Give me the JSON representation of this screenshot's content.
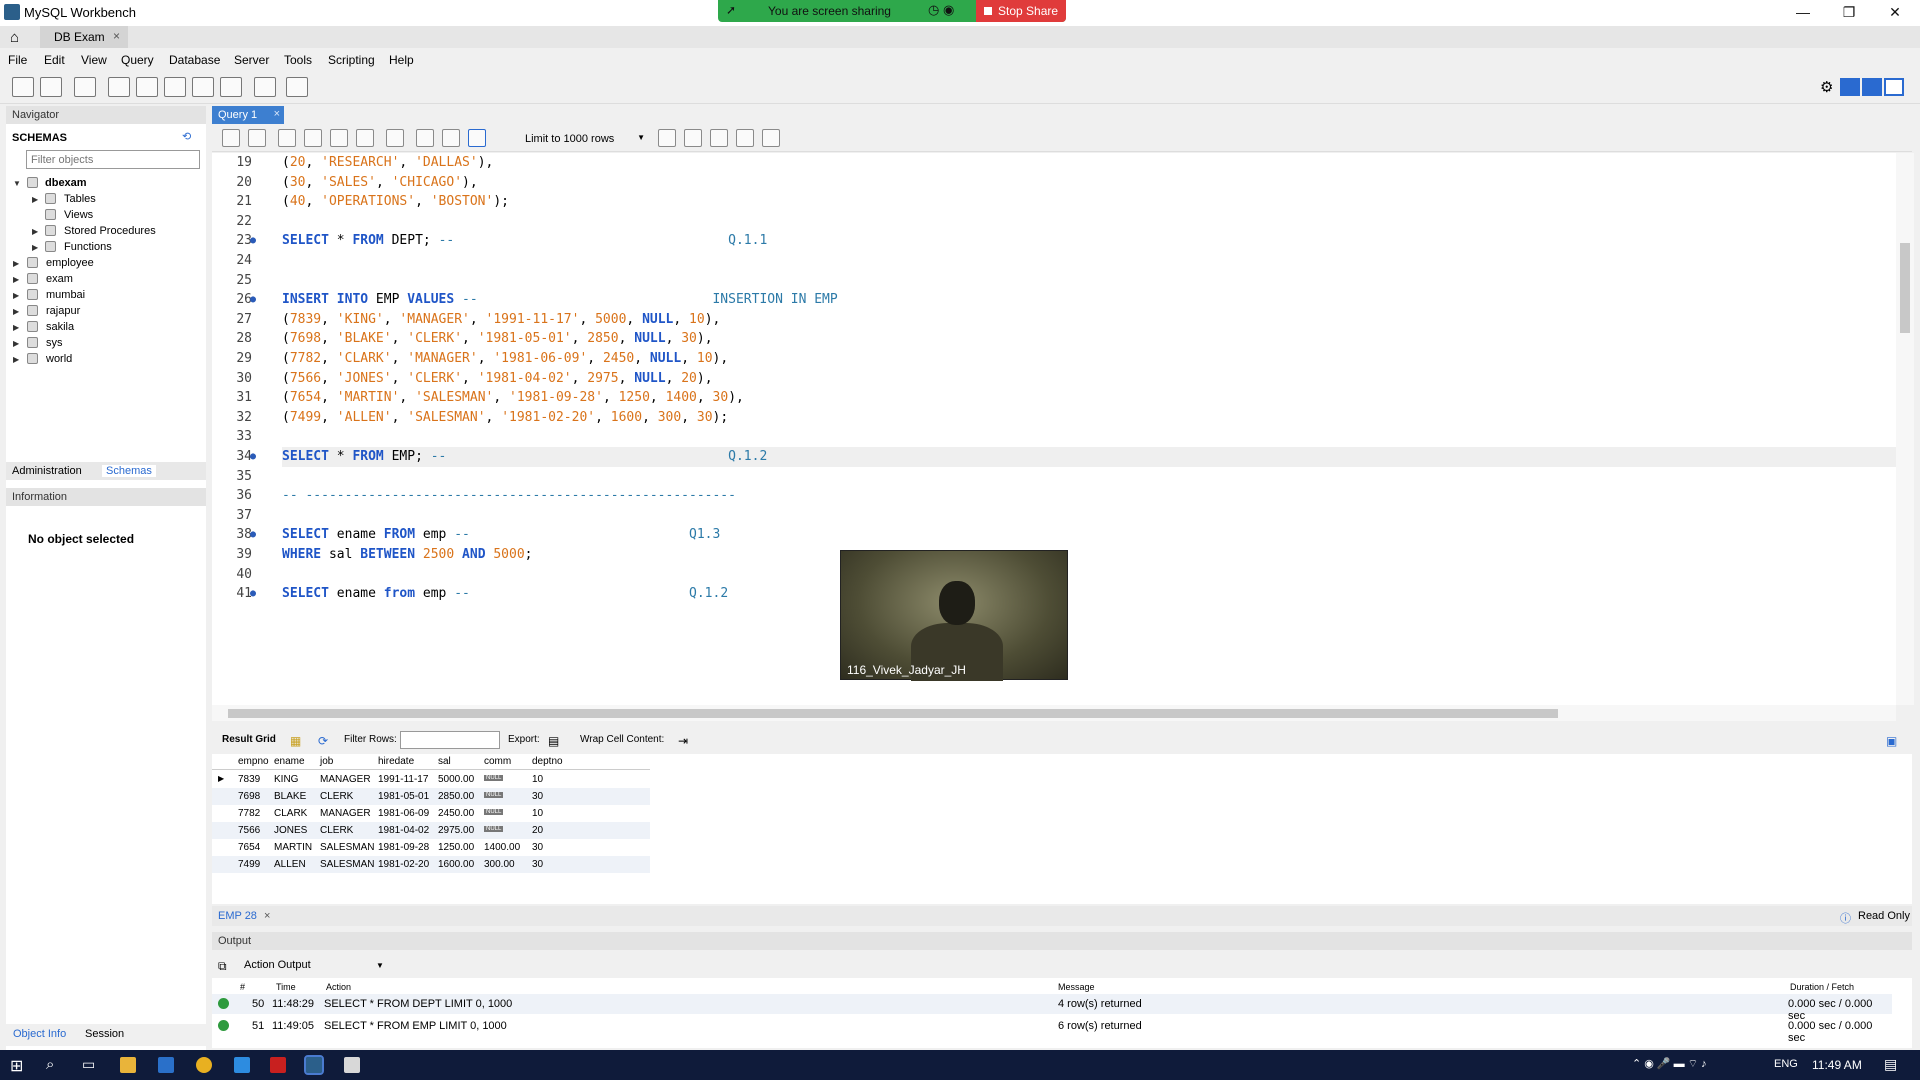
{
  "window": {
    "title": "MySQL Workbench",
    "minimize": "—",
    "restore": "❐",
    "close": "✕"
  },
  "share": {
    "message": "You are screen sharing",
    "stop_label": "Stop Share"
  },
  "connection_tab": {
    "label": "DB Exam",
    "close": "×"
  },
  "menu": [
    "File",
    "Edit",
    "View",
    "Query",
    "Database",
    "Server",
    "Tools",
    "Scripting",
    "Help"
  ],
  "navigator": {
    "header": "Navigator",
    "schemas_title": "SCHEMAS",
    "filter_placeholder": "Filter objects",
    "tree": {
      "db": "dbexam",
      "children": [
        "Tables",
        "Views",
        "Stored Procedures",
        "Functions"
      ],
      "schemas": [
        "employee",
        "exam",
        "mumbai",
        "rajapur",
        "sakila",
        "sys",
        "world"
      ]
    },
    "tabs": [
      "Administration",
      "Schemas"
    ],
    "info_header": "Information",
    "no_object": "No object selected",
    "bottom_tabs": [
      "Object Info",
      "Session"
    ]
  },
  "query_tab": {
    "label": "Query 1",
    "close": "×"
  },
  "editor_toolbar": {
    "limit_label": "Limit to 1000 rows"
  },
  "editor": {
    "lines": [
      {
        "n": "19",
        "dot": false,
        "html": "(<span class='num'>20</span>, <span class='str'>'RESEARCH'</span>, <span class='str'>'DALLAS'</span>),"
      },
      {
        "n": "20",
        "dot": false,
        "html": "(<span class='num'>30</span>, <span class='str'>'SALES'</span>, <span class='str'>'CHICAGO'</span>),"
      },
      {
        "n": "21",
        "dot": false,
        "html": "(<span class='num'>40</span>, <span class='str'>'OPERATIONS'</span>, <span class='str'>'BOSTON'</span>);"
      },
      {
        "n": "22",
        "dot": false,
        "html": ""
      },
      {
        "n": "23",
        "dot": true,
        "html": "<span class='kw'>SELECT</span> * <span class='kw'>FROM</span> DEPT; <span class='cmt'>--                                   Q.1.1</span>"
      },
      {
        "n": "24",
        "dot": false,
        "html": ""
      },
      {
        "n": "25",
        "dot": false,
        "html": ""
      },
      {
        "n": "26",
        "dot": true,
        "html": "<span class='kw'>INSERT INTO</span> EMP <span class='kw'>VALUES</span> <span class='cmt'>--                              INSERTION IN EMP</span>"
      },
      {
        "n": "27",
        "dot": false,
        "html": "(<span class='num'>7839</span>, <span class='str'>'KING'</span>, <span class='str'>'MANAGER'</span>, <span class='str'>'1991-11-17'</span>, <span class='num'>5000</span>, <span class='kw'>NULL</span>, <span class='num'>10</span>),"
      },
      {
        "n": "28",
        "dot": false,
        "html": "(<span class='num'>7698</span>, <span class='str'>'BLAKE'</span>, <span class='str'>'CLERK'</span>, <span class='str'>'1981-05-01'</span>, <span class='num'>2850</span>, <span class='kw'>NULL</span>, <span class='num'>30</span>),"
      },
      {
        "n": "29",
        "dot": false,
        "html": "(<span class='num'>7782</span>, <span class='str'>'CLARK'</span>, <span class='str'>'MANAGER'</span>, <span class='str'>'1981-06-09'</span>, <span class='num'>2450</span>, <span class='kw'>NULL</span>, <span class='num'>10</span>),"
      },
      {
        "n": "30",
        "dot": false,
        "html": "(<span class='num'>7566</span>, <span class='str'>'JONES'</span>, <span class='str'>'CLERK'</span>, <span class='str'>'1981-04-02'</span>, <span class='num'>2975</span>, <span class='kw'>NULL</span>, <span class='num'>20</span>),"
      },
      {
        "n": "31",
        "dot": false,
        "html": "(<span class='num'>7654</span>, <span class='str'>'MARTIN'</span>, <span class='str'>'SALESMAN'</span>, <span class='str'>'1981-09-28'</span>, <span class='num'>1250</span>, <span class='num'>1400</span>, <span class='num'>30</span>),"
      },
      {
        "n": "32",
        "dot": false,
        "html": "(<span class='num'>7499</span>, <span class='str'>'ALLEN'</span>, <span class='str'>'SALESMAN'</span>, <span class='str'>'1981-02-20'</span>, <span class='num'>1600</span>, <span class='num'>300</span>, <span class='num'>30</span>);"
      },
      {
        "n": "33",
        "dot": false,
        "html": ""
      },
      {
        "n": "34",
        "dot": true,
        "html": "<span class='kw'>SELECT</span> * <span class='kw'>FROM</span> EMP; <span class='cmt'>--                                    Q.1.2</span>",
        "current": true
      },
      {
        "n": "35",
        "dot": false,
        "html": ""
      },
      {
        "n": "36",
        "dot": false,
        "html": "<span class='cmt'>-- -------------------------------------------------------</span>"
      },
      {
        "n": "37",
        "dot": false,
        "html": ""
      },
      {
        "n": "38",
        "dot": true,
        "html": "<span class='kw'>SELECT</span> ename <span class='kw'>FROM</span> emp <span class='cmt'>--                            Q1.3</span>"
      },
      {
        "n": "39",
        "dot": false,
        "html": "<span class='kw'>WHERE</span> sal <span class='kw'>BETWEEN</span> <span class='num'>2500</span> <span class='kw'>AND</span> <span class='num'>5000</span>;"
      },
      {
        "n": "40",
        "dot": false,
        "html": ""
      },
      {
        "n": "41",
        "dot": true,
        "html": "<span class='kw'>SELECT</span> ename <span class='kw'>from</span> emp <span class='cmt'>--                            Q.1.2</span>"
      }
    ]
  },
  "webcam": {
    "name": "116_Vivek_Jadyar_JH"
  },
  "result_toolbar": {
    "result_grid": "Result Grid",
    "filter_rows": "Filter Rows:",
    "export": "Export:",
    "wrap": "Wrap Cell Content:"
  },
  "grid": {
    "columns": [
      "empno",
      "ename",
      "job",
      "hiredate",
      "sal",
      "comm",
      "deptno"
    ],
    "null_badge": "NULL",
    "rows": [
      [
        "7839",
        "KING",
        "MANAGER",
        "1991-11-17",
        "5000.00",
        null,
        "10"
      ],
      [
        "7698",
        "BLAKE",
        "CLERK",
        "1981-05-01",
        "2850.00",
        null,
        "30"
      ],
      [
        "7782",
        "CLARK",
        "MANAGER",
        "1981-06-09",
        "2450.00",
        null,
        "10"
      ],
      [
        "7566",
        "JONES",
        "CLERK",
        "1981-04-02",
        "2975.00",
        null,
        "20"
      ],
      [
        "7654",
        "MARTIN",
        "SALESMAN",
        "1981-09-28",
        "1250.00",
        "1400.00",
        "30"
      ],
      [
        "7499",
        "ALLEN",
        "SALESMAN",
        "1981-02-20",
        "1600.00",
        "300.00",
        "30"
      ]
    ]
  },
  "result_tab": {
    "label": "EMP 28",
    "close": "×",
    "readonly": "Read Only"
  },
  "output": {
    "header": "Output",
    "selector": "Action Output",
    "columns": [
      "#",
      "Time",
      "Action",
      "Message",
      "Duration / Fetch"
    ],
    "rows": [
      {
        "num": "50",
        "time": "11:48:29",
        "action": "SELECT * FROM DEPT LIMIT 0, 1000",
        "message": "4 row(s) returned",
        "duration": "0.000 sec / 0.000 sec"
      },
      {
        "num": "51",
        "time": "11:49:05",
        "action": "SELECT * FROM EMP LIMIT 0, 1000",
        "message": "6 row(s) returned",
        "duration": "0.000 sec / 0.000 sec"
      }
    ]
  },
  "taskbar": {
    "lang": "ENG",
    "time": "11:49 AM"
  }
}
